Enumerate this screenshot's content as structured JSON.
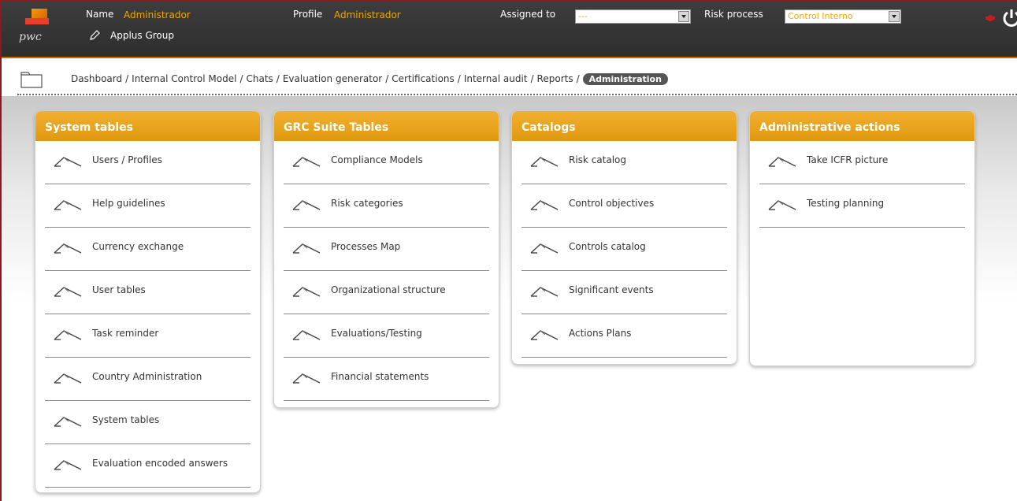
{
  "header": {
    "logo_text": "pwc",
    "name_label": "Name",
    "name_value": "Administrador",
    "profile_label": "Profile",
    "profile_value": "Administrador",
    "company": "Applus Group",
    "assigned_label": "Assigned to",
    "assigned_value": "---",
    "risk_label": "Risk process",
    "risk_value": "Control Interno"
  },
  "breadcrumb": {
    "items": [
      "Dashboard",
      "Internal Control Model",
      "Chats",
      "Evaluation generator",
      "Certifications",
      "Internal audit",
      "Reports"
    ],
    "active": "Administration"
  },
  "panels": [
    {
      "title": "System tables",
      "items": [
        "Users / Profiles",
        "Help guidelines",
        "Currency exchange",
        "User tables",
        "Task reminder",
        "Country Administration",
        "System tables",
        "Evaluation encoded answers"
      ]
    },
    {
      "title": "GRC Suite Tables",
      "items": [
        "Compliance Models",
        "Risk categories",
        "Processes Map",
        "Organizational structure",
        "Evaluations/Testing",
        "Financial statements"
      ]
    },
    {
      "title": "Catalogs",
      "items": [
        "Risk catalog",
        "Control objectives",
        "Controls catalog",
        "Significant events",
        "Actions Plans"
      ]
    },
    {
      "title": "Administrative actions",
      "items": [
        "Take ICFR picture",
        "Testing planning"
      ]
    }
  ],
  "colors": {
    "accent": "#f0a800",
    "header_bg": "#333333",
    "panel_header": "#e8a020"
  }
}
